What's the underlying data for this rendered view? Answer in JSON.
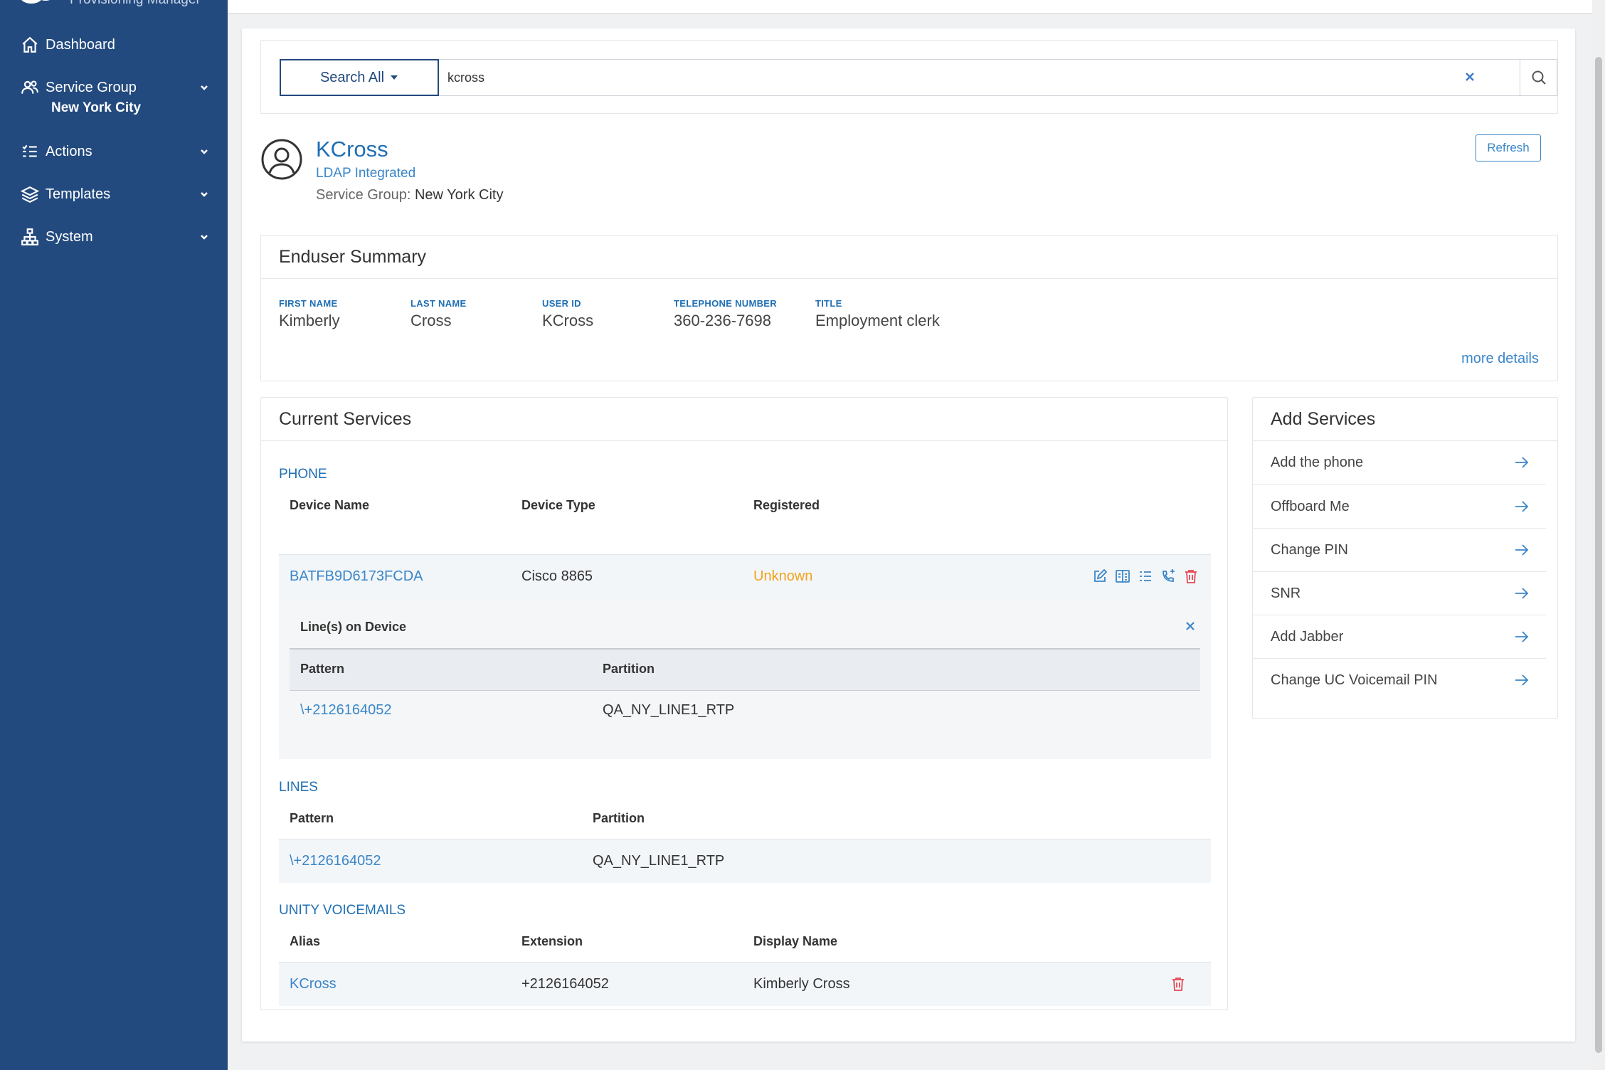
{
  "brand": {
    "name": "Provisioning Manager"
  },
  "sidebar": {
    "items": [
      {
        "label": "Dashboard",
        "icon": "home-icon"
      },
      {
        "label": "Service Group",
        "sub": "New York City",
        "icon": "users-icon"
      },
      {
        "label": "Actions",
        "icon": "list-check-icon"
      },
      {
        "label": "Templates",
        "icon": "layers-icon"
      },
      {
        "label": "System",
        "icon": "sitemap-icon"
      }
    ]
  },
  "search": {
    "scope": "Search All",
    "value": "kcross"
  },
  "user": {
    "name": "KCross",
    "ldap": "LDAP Integrated",
    "sg_label": "Service Group:",
    "sg_value": "New York City",
    "refresh": "Refresh"
  },
  "summary": {
    "title": "Enduser Summary",
    "fields": [
      {
        "label": "FIRST NAME",
        "value": "Kimberly"
      },
      {
        "label": "LAST NAME",
        "value": "Cross"
      },
      {
        "label": "USER ID",
        "value": "KCross"
      },
      {
        "label": "TELEPHONE NUMBER",
        "value": "360-236-7698"
      },
      {
        "label": "TITLE",
        "value": "Employment clerk"
      }
    ],
    "more": "more details"
  },
  "services": {
    "title": "Current Services",
    "phone": {
      "section": "PHONE",
      "headers": [
        "Device Name",
        "Device Type",
        "Registered"
      ],
      "row": {
        "device": "BATFB9D6173FCDA",
        "type": "Cisco 8865",
        "registered": "Unknown"
      },
      "lines_panel": {
        "title": "Line(s) on Device",
        "headers": [
          "Pattern",
          "Partition"
        ],
        "row": {
          "pattern": "\\+2126164052",
          "partition": "QA_NY_LINE1_RTP"
        }
      }
    },
    "lines": {
      "section": "LINES",
      "headers": [
        "Pattern",
        "Partition"
      ],
      "row": {
        "pattern": "\\+2126164052",
        "partition": "QA_NY_LINE1_RTP"
      }
    },
    "voicemail": {
      "section": "UNITY VOICEMAILS",
      "headers": [
        "Alias",
        "Extension",
        "Display Name"
      ],
      "row": {
        "alias": "KCross",
        "extension": "+2126164052",
        "display": "Kimberly Cross"
      }
    }
  },
  "add_services": {
    "title": "Add Services",
    "items": [
      "Add the phone",
      "Offboard Me",
      "Change PIN",
      "SNR",
      "Add Jabber",
      "Change UC Voicemail PIN"
    ]
  },
  "colors": {
    "sidebar": "#234a7e",
    "link": "#3a86c8",
    "warning": "#f2a21c",
    "danger": "#e34850"
  }
}
